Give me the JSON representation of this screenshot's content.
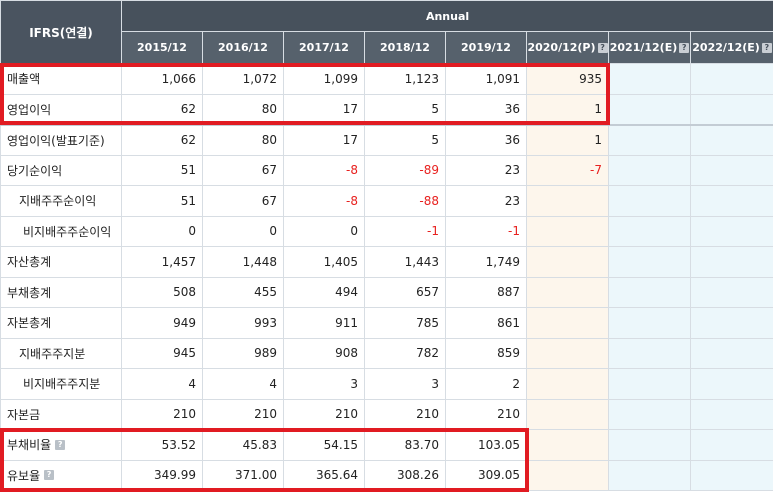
{
  "header": {
    "corner_label": "IFRS(연결)",
    "group_label": "Annual",
    "columns": [
      "2015/12",
      "2016/12",
      "2017/12",
      "2018/12",
      "2019/12",
      "2020/12(P)",
      "2021/12(E)",
      "2022/12(E)"
    ],
    "info_icon_glyph": "?"
  },
  "rows": [
    {
      "label": "매출액",
      "values": [
        "1,066",
        "1,072",
        "1,099",
        "1,123",
        "1,091",
        "935",
        "",
        ""
      ]
    },
    {
      "label": "영업이익",
      "values": [
        "62",
        "80",
        "17",
        "5",
        "36",
        "1",
        "",
        ""
      ]
    },
    {
      "label": "영업이익(발표기준)",
      "values": [
        "62",
        "80",
        "17",
        "5",
        "36",
        "1",
        "",
        ""
      ]
    },
    {
      "label": "당기순이익",
      "values": [
        "51",
        "67",
        "-8",
        "-89",
        "23",
        "-7",
        "",
        ""
      ]
    },
    {
      "label": "지배주주순이익",
      "values": [
        "51",
        "67",
        "-8",
        "-88",
        "23",
        "",
        "",
        ""
      ]
    },
    {
      "label": "비지배주주순이익",
      "values": [
        "0",
        "0",
        "0",
        "-1",
        "-1",
        "",
        "",
        ""
      ]
    },
    {
      "label": "자산총계",
      "values": [
        "1,457",
        "1,448",
        "1,405",
        "1,443",
        "1,749",
        "",
        "",
        ""
      ]
    },
    {
      "label": "부채총계",
      "values": [
        "508",
        "455",
        "494",
        "657",
        "887",
        "",
        "",
        ""
      ]
    },
    {
      "label": "자본총계",
      "values": [
        "949",
        "993",
        "911",
        "785",
        "861",
        "",
        "",
        ""
      ]
    },
    {
      "label": "지배주주지분",
      "values": [
        "945",
        "989",
        "908",
        "782",
        "859",
        "",
        "",
        ""
      ]
    },
    {
      "label": "비지배주주지분",
      "values": [
        "4",
        "4",
        "3",
        "3",
        "2",
        "",
        "",
        ""
      ]
    },
    {
      "label": "자본금",
      "values": [
        "210",
        "210",
        "210",
        "210",
        "210",
        "",
        "",
        ""
      ]
    },
    {
      "label": "부채비율",
      "values": [
        "53.52",
        "45.83",
        "54.15",
        "83.70",
        "103.05",
        "",
        "",
        ""
      ]
    },
    {
      "label": "유보율",
      "values": [
        "349.99",
        "371.00",
        "365.64",
        "308.26",
        "309.05",
        "",
        "",
        ""
      ]
    }
  ],
  "colors": {
    "header_bg": "#47515c",
    "negative": "#e8211f",
    "provisional_bg": "#fdf6ec",
    "estimate_bg": "#ecf7fb",
    "highlight_border": "#e11b22"
  }
}
